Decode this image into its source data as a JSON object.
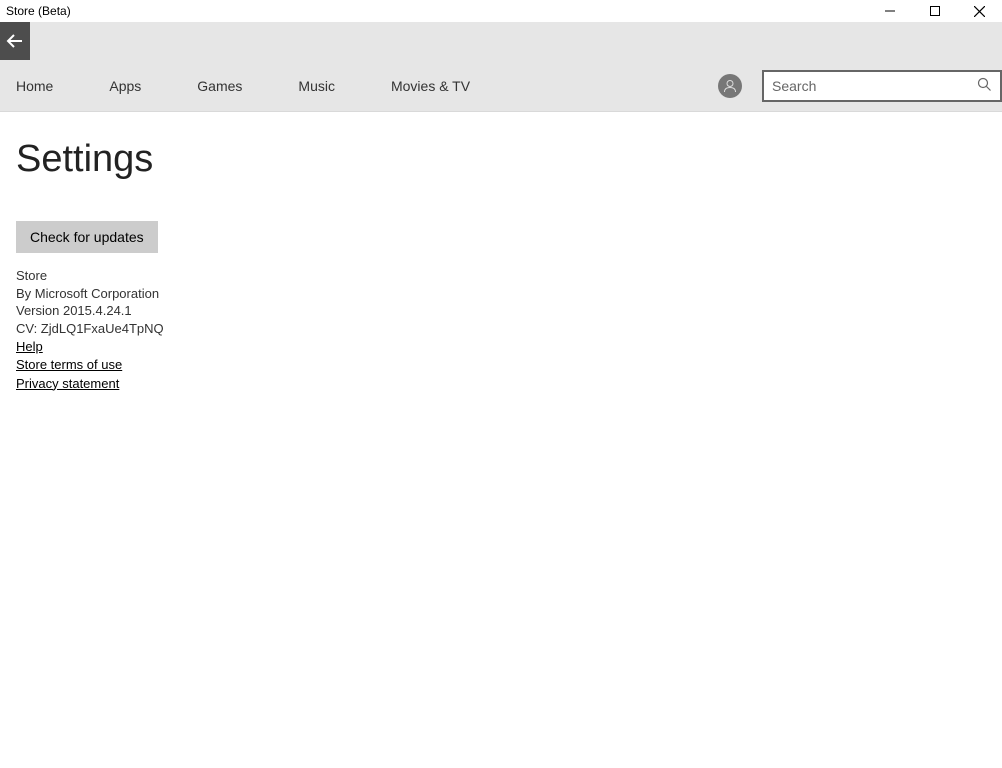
{
  "window": {
    "title": "Store (Beta)"
  },
  "nav": {
    "items": [
      "Home",
      "Apps",
      "Games",
      "Music",
      "Movies & TV"
    ]
  },
  "search": {
    "placeholder": "Search"
  },
  "page": {
    "title": "Settings",
    "check_updates_label": "Check for updates",
    "info": {
      "app_name": "Store",
      "by_line": "By Microsoft Corporation",
      "version": "Version 2015.4.24.1",
      "cv": "CV: ZjdLQ1FxaUe4TpNQ"
    },
    "links": {
      "help": "Help",
      "terms": "Store terms of use",
      "privacy": "Privacy statement"
    }
  }
}
